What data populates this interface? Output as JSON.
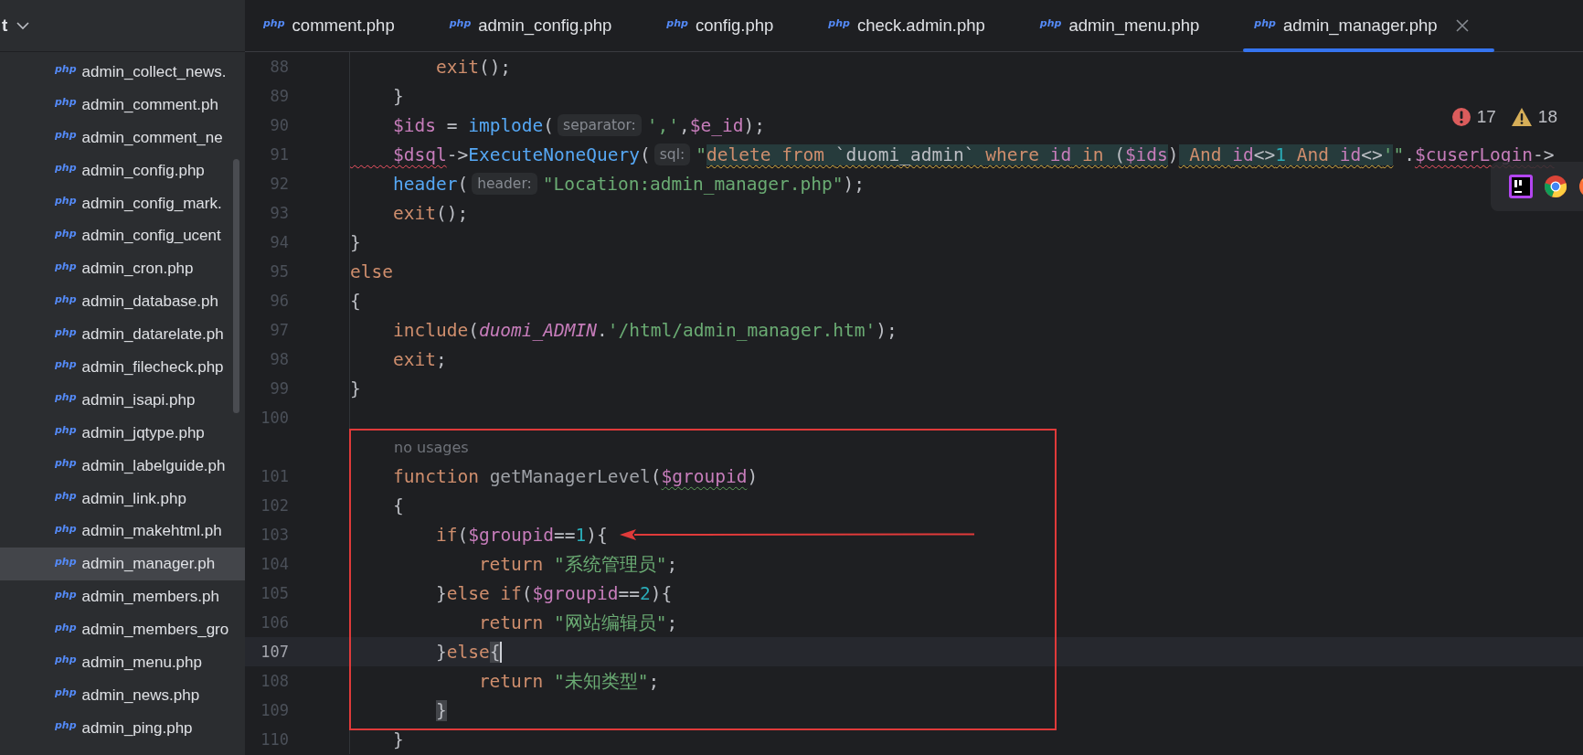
{
  "sidebar": {
    "header": "t",
    "files": [
      {
        "badge": "php",
        "name": "admin_collect_news.",
        "selected": false
      },
      {
        "badge": "php",
        "name": "admin_comment.ph",
        "selected": false
      },
      {
        "badge": "php",
        "name": "admin_comment_ne",
        "selected": false
      },
      {
        "badge": "php",
        "name": "admin_config.php",
        "selected": false
      },
      {
        "badge": "php",
        "name": "admin_config_mark.",
        "selected": false
      },
      {
        "badge": "php",
        "name": "admin_config_ucent",
        "selected": false
      },
      {
        "badge": "php",
        "name": "admin_cron.php",
        "selected": false
      },
      {
        "badge": "php",
        "name": "admin_database.ph",
        "selected": false
      },
      {
        "badge": "php",
        "name": "admin_datarelate.ph",
        "selected": false
      },
      {
        "badge": "php",
        "name": "admin_filecheck.php",
        "selected": false
      },
      {
        "badge": "php",
        "name": "admin_isapi.php",
        "selected": false
      },
      {
        "badge": "php",
        "name": "admin_jqtype.php",
        "selected": false
      },
      {
        "badge": "php",
        "name": "admin_labelguide.ph",
        "selected": false
      },
      {
        "badge": "php",
        "name": "admin_link.php",
        "selected": false
      },
      {
        "badge": "php",
        "name": "admin_makehtml.ph",
        "selected": false
      },
      {
        "badge": "php",
        "name": "admin_manager.ph",
        "selected": true
      },
      {
        "badge": "php",
        "name": "admin_members.ph",
        "selected": false
      },
      {
        "badge": "php",
        "name": "admin_members_gro",
        "selected": false
      },
      {
        "badge": "php",
        "name": "admin_menu.php",
        "selected": false
      },
      {
        "badge": "php",
        "name": "admin_news.php",
        "selected": false
      },
      {
        "badge": "php",
        "name": "admin_ping.php",
        "selected": false
      }
    ]
  },
  "tabs": [
    {
      "badge": "php",
      "label": "comment.php",
      "selected": false
    },
    {
      "badge": "php",
      "label": "admin_config.php",
      "selected": false
    },
    {
      "badge": "php",
      "label": "config.php",
      "selected": false
    },
    {
      "badge": "php",
      "label": "check.admin.php",
      "selected": false
    },
    {
      "badge": "php",
      "label": "admin_menu.php",
      "selected": false
    },
    {
      "badge": "php",
      "label": "admin_manager.php",
      "selected": true
    }
  ],
  "problems": {
    "errors": "17",
    "warnings": "18"
  },
  "editor": {
    "lines": [
      {
        "kind": "code",
        "number": "88",
        "current": false,
        "tokens": [
          {
            "kind": "kw",
            "text": "        exit"
          },
          {
            "kind": "plain",
            "text": "();"
          }
        ]
      },
      {
        "kind": "code",
        "number": "89",
        "current": false,
        "tokens": [
          {
            "kind": "plain",
            "text": "    }"
          }
        ]
      },
      {
        "kind": "code",
        "number": "90",
        "current": false,
        "tokens": [
          {
            "kind": "var",
            "text": "    $ids"
          },
          {
            "kind": "plain",
            "text": " = "
          },
          {
            "kind": "fn",
            "text": "implode"
          },
          {
            "kind": "plain",
            "text": "("
          },
          {
            "kind": "hint",
            "text": "separator:"
          },
          {
            "kind": "str",
            "text": "','"
          },
          {
            "kind": "plain",
            "text": ","
          },
          {
            "kind": "var",
            "text": "$e_id"
          },
          {
            "kind": "plain",
            "text": ");"
          }
        ]
      },
      {
        "kind": "code",
        "number": "91",
        "current": false,
        "tokens": [
          {
            "kind": "var",
            "text": "    $dsql",
            "error": true
          },
          {
            "kind": "plain",
            "text": "->"
          },
          {
            "kind": "fn",
            "text": "ExecuteNoneQuery"
          },
          {
            "kind": "plain",
            "text": "("
          },
          {
            "kind": "hint",
            "text": "sql:"
          },
          {
            "kind": "str",
            "text": "\""
          },
          {
            "kind": "sql_kw",
            "text": "delete from ",
            "injected": true,
            "warning": true
          },
          {
            "kind": "sql_id",
            "text": "`duomi_admin` ",
            "injected": true,
            "warning": true
          },
          {
            "kind": "sql_kw",
            "text": "where ",
            "injected": true,
            "warning": true
          },
          {
            "kind": "var",
            "text": "id",
            "injected": true,
            "warning": true
          },
          {
            "kind": "sql_kw",
            "text": " in ",
            "injected": true,
            "warning": true
          },
          {
            "kind": "plain",
            "text": "(",
            "injected": true,
            "warning": true
          },
          {
            "kind": "var",
            "text": "$ids",
            "injected": true,
            "warning": true
          },
          {
            "kind": "plain",
            "text": ")"
          },
          {
            "kind": "sql_kw",
            "text": " And ",
            "injected": true,
            "warning": true
          },
          {
            "kind": "var",
            "text": "id",
            "injected": true,
            "warning": true
          },
          {
            "kind": "plain",
            "text": "<>",
            "injected": true,
            "warning": true
          },
          {
            "kind": "num",
            "text": "1",
            "injected": true,
            "warning": true
          },
          {
            "kind": "sql_kw",
            "text": " And ",
            "injected": true,
            "warning": true
          },
          {
            "kind": "var",
            "text": "id",
            "injected": true,
            "warning": true
          },
          {
            "kind": "plain",
            "text": "<>",
            "injected": true,
            "warning": true
          },
          {
            "kind": "str",
            "text": "'",
            "injected": true,
            "warning": true
          },
          {
            "kind": "str",
            "text": "\""
          },
          {
            "kind": "plain",
            "text": "."
          },
          {
            "kind": "var",
            "text": "$cuserLogin",
            "error": true
          },
          {
            "kind": "plain",
            "text": "->",
            "error": true
          }
        ]
      },
      {
        "kind": "code",
        "number": "92",
        "current": false,
        "tokens": [
          {
            "kind": "fn",
            "text": "    header"
          },
          {
            "kind": "plain",
            "text": "("
          },
          {
            "kind": "hint",
            "text": "header:"
          },
          {
            "kind": "str",
            "text": "\"Location:admin_manager.php\""
          },
          {
            "kind": "plain",
            "text": ");"
          }
        ]
      },
      {
        "kind": "code",
        "number": "93",
        "current": false,
        "tokens": [
          {
            "kind": "kw",
            "text": "    exit"
          },
          {
            "kind": "plain",
            "text": "();"
          }
        ]
      },
      {
        "kind": "code",
        "number": "94",
        "current": false,
        "tokens": [
          {
            "kind": "plain",
            "text": "}"
          }
        ]
      },
      {
        "kind": "code",
        "number": "95",
        "current": false,
        "tokens": [
          {
            "kind": "kw",
            "text": "else"
          }
        ]
      },
      {
        "kind": "code",
        "number": "96",
        "current": false,
        "tokens": [
          {
            "kind": "plain",
            "text": "{"
          }
        ]
      },
      {
        "kind": "code",
        "number": "97",
        "current": false,
        "tokens": [
          {
            "kind": "kw",
            "text": "    include"
          },
          {
            "kind": "plain",
            "text": "("
          },
          {
            "kind": "const",
            "text": "duomi_ADMIN"
          },
          {
            "kind": "plain",
            "text": "."
          },
          {
            "kind": "str",
            "text": "'/html/admin_manager.htm'"
          },
          {
            "kind": "plain",
            "text": ");"
          }
        ]
      },
      {
        "kind": "code",
        "number": "98",
        "current": false,
        "tokens": [
          {
            "kind": "kw",
            "text": "    exit"
          },
          {
            "kind": "plain",
            "text": ";"
          }
        ]
      },
      {
        "kind": "code",
        "number": "99",
        "current": false,
        "tokens": [
          {
            "kind": "plain",
            "text": "}"
          }
        ]
      },
      {
        "kind": "code",
        "number": "100",
        "current": false
      },
      {
        "kind": "usage_hint",
        "text": "no usages"
      },
      {
        "kind": "code",
        "number": "101",
        "current": false,
        "tokens": [
          {
            "kind": "kw",
            "text": "    function "
          },
          {
            "kind": "decl",
            "text": "getManagerLevel"
          },
          {
            "kind": "plain",
            "text": "("
          },
          {
            "kind": "var",
            "text": "$groupid",
            "weak_warning": true
          },
          {
            "kind": "plain",
            "text": ")"
          }
        ]
      },
      {
        "kind": "code",
        "number": "102",
        "current": false,
        "tokens": [
          {
            "kind": "plain",
            "text": "    {"
          }
        ]
      },
      {
        "kind": "code",
        "number": "103",
        "current": false,
        "tokens": [
          {
            "kind": "kw",
            "text": "        if"
          },
          {
            "kind": "plain",
            "text": "("
          },
          {
            "kind": "var",
            "text": "$groupid"
          },
          {
            "kind": "plain",
            "text": "=="
          },
          {
            "kind": "num",
            "text": "1"
          },
          {
            "kind": "plain",
            "text": "){"
          }
        ]
      },
      {
        "kind": "code",
        "number": "104",
        "current": false,
        "tokens": [
          {
            "kind": "kw",
            "text": "            return "
          },
          {
            "kind": "str",
            "text": "\"系统管理员\""
          },
          {
            "kind": "plain",
            "text": ";"
          }
        ]
      },
      {
        "kind": "code",
        "number": "105",
        "current": false,
        "tokens": [
          {
            "kind": "plain",
            "text": "        }"
          },
          {
            "kind": "kw",
            "text": "else if"
          },
          {
            "kind": "plain",
            "text": "("
          },
          {
            "kind": "var",
            "text": "$groupid"
          },
          {
            "kind": "plain",
            "text": "=="
          },
          {
            "kind": "num",
            "text": "2"
          },
          {
            "kind": "plain",
            "text": "){"
          }
        ]
      },
      {
        "kind": "code",
        "number": "106",
        "current": false,
        "tokens": [
          {
            "kind": "kw",
            "text": "            return "
          },
          {
            "kind": "str",
            "text": "\"网站编辑员\""
          },
          {
            "kind": "plain",
            "text": ";"
          }
        ]
      },
      {
        "kind": "code",
        "number": "107",
        "current": true,
        "tokens": [
          {
            "kind": "plain",
            "text": "        }"
          },
          {
            "kind": "kw",
            "text": "else"
          },
          {
            "kind": "plain",
            "text": "{",
            "matched": true,
            "caret": true
          }
        ]
      },
      {
        "kind": "code",
        "number": "108",
        "current": false,
        "tokens": [
          {
            "kind": "kw",
            "text": "            return "
          },
          {
            "kind": "str",
            "text": "\"未知类型\""
          },
          {
            "kind": "plain",
            "text": ";"
          }
        ]
      },
      {
        "kind": "code",
        "number": "109",
        "current": false,
        "tokens": [
          {
            "kind": "plain",
            "text": "        }",
            "matched": true
          }
        ]
      },
      {
        "kind": "code",
        "number": "110",
        "current": false,
        "tokens": [
          {
            "kind": "plain",
            "text": "    }"
          }
        ]
      }
    ]
  }
}
